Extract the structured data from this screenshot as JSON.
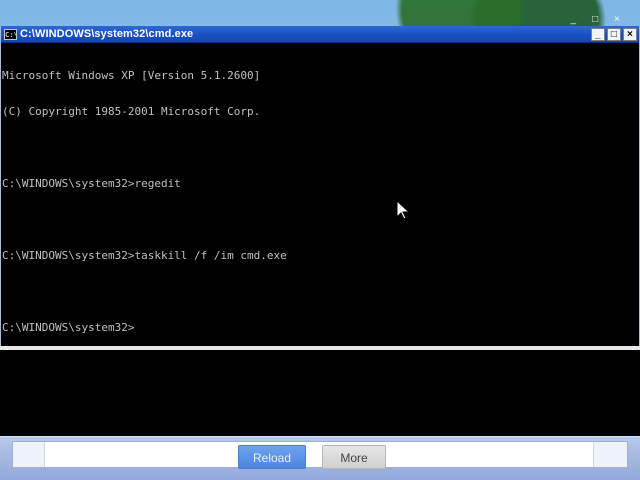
{
  "window": {
    "title": "C:\\WINDOWS\\system32\\cmd.exe",
    "icon": "console-icon",
    "controls": {
      "minimize": "_",
      "maximize": "□",
      "close": "×"
    }
  },
  "console": {
    "lines": [
      "Microsoft Windows XP [Version 5.1.2600]",
      "(C) Copyright 1985-2001 Microsoft Corp.",
      "",
      "C:\\WINDOWS\\system32>regedit",
      "",
      "C:\\WINDOWS\\system32>taskkill /f /im cmd.exe",
      "",
      "C:\\WINDOWS\\system32>"
    ]
  },
  "desktop_controls": {
    "minimize": "_",
    "maximize": "□",
    "close": "×"
  },
  "bottom_bar": {
    "reload_label": "Reload",
    "more_label": "More"
  },
  "icons": {
    "cursor": "arrow-cursor-icon"
  }
}
